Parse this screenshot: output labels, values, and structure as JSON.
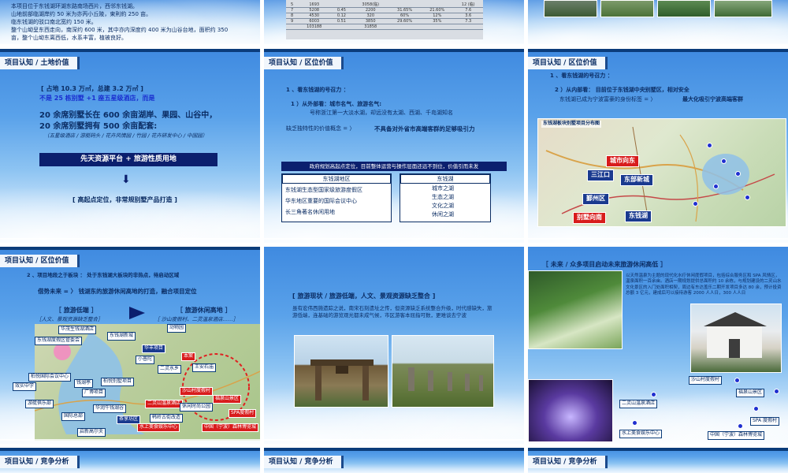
{
  "colors": {
    "slide_top": "#3f8ae0",
    "navy": "#0b2d64",
    "banner": "#0b1f6e",
    "red": "#d81c1c",
    "pin": "#1f2fd0"
  },
  "s1": {
    "lines": [
      "本项目位于东钱湖环湖东路南场西片，西邻东钱湖。",
      "山地前部临湖岸约 50 米为亦丙小丘陵，東則約 250 亩。",
      "临东钱湖的驳口南北宽约 150 米。",
      "整个山坳呈东西走向，南深约 600 米，其中亦内深度约 400 米为山谷台地，面积约 350",
      "亩，整个山坳东离西低，水系丰富，植被良好。"
    ]
  },
  "s2": {
    "rows": [
      [
        "5",
        "1693",
        "",
        "3058(临)",
        "",
        "",
        "12 (临)"
      ],
      [
        "7",
        "5208",
        "0.45",
        "2200",
        "31.65%",
        "21.60%",
        "7.6"
      ],
      [
        "8",
        "4530",
        "0.12",
        "320",
        "60%",
        "12%",
        "3.6"
      ],
      [
        "9",
        "6003",
        "0.51",
        "3850",
        "29.60%",
        "35%",
        "7.3"
      ],
      [
        "",
        "103188",
        "",
        "31858",
        "",
        "",
        ""
      ]
    ]
  },
  "s4": {
    "tag": "项目认知 / 土地价值",
    "line1": "[ 占地 10.3 万㎡，总建 3.2 万㎡ ]",
    "line2": "不是 25 栋别墅 +1 座五星级酒店，而是",
    "head1": "20 余席别墅长在 600 余亩湖岸、果园、山谷中，",
    "head2": "20 余席别墅拥有 500 余亩配套:",
    "sub": "（五星级酒店 / 游艇码头 / 花卉风情园 / 竹园 / 花卉研发中心 / 中国园）",
    "banner": "先天资源平台 + 旅游性质用地",
    "arrow": "⬇",
    "conclusion": "[ 高起点定位，非常规别墅产品打造 ]"
  },
  "s5": {
    "tag": "项目认知 / 区位价值",
    "h1": "1 、看东钱湖的号召力 ：",
    "p1": "1 ）从外部看：城市名气、旅游名气:",
    "p1b": "号称浙江第一大淡水湖，却远没有太湖、西湖、千岛湖知名",
    "p2": "缺乏独特性的价值概念  = 〉",
    "p2b": "不具备对外省市高端客群的足够吸引力",
    "banner": "政府规划高起点定位，目前整体运营与操作层面还远不到位，价值引而未发",
    "col1_head": "东钱湖地区",
    "col1": [
      "东钱湖生态型国家级旅游度假区",
      "华东地区重要的国际会议中心",
      "长三角著名休闲用地"
    ],
    "col2_head": "东钱湖",
    "col2": [
      "城市之湖",
      "生态之湖",
      "文化之湖",
      "休闲之湖"
    ]
  },
  "s6": {
    "tag": "项目认知 / 区位价值",
    "h1": "1 、看东钱湖的号召力 ：",
    "p1": "2 ）从内部看： 目前位于东钱湖中央别墅区，相对安全",
    "p1b": "东钱湖已成为宁波富豪的身份标签  = 〉",
    "p1c": "最大化吸引宁波高端客群",
    "map_title": "东钱湖板块别墅项目分布图",
    "labels": [
      "城市向东",
      "三江口",
      "东部新城",
      "鄞州区",
      "东钱湖",
      "别墅向南"
    ]
  },
  "s7": {
    "tag": "项目认知 / 区位价值",
    "h2": "2 、项目地段之于板块 ： 处于东钱湖大板块的非热点，待启动区域",
    "p": "借势未来 = 〉 钱湖东的旅游休闲高地的打造，融合项目定位",
    "left_head": "［ 旅游低端 ］",
    "left_sub": "［人文、景观资源缺乏整合］",
    "right_head": "［ 旅游休闲高地 ］",
    "right_sub": "［ 沙山度假村、二灵温泉酒店……］",
    "pins": [
      "华茂生钱湖酒店",
      "东钱湖度假区管委会",
      "东钱湖新城",
      "动物园",
      "华丰项目",
      "小普陀",
      "二灵水乡",
      "王安石庙",
      "本案",
      "柏悦国际会议中心",
      "柏悦别墅项目",
      "效实中学",
      "钱湖亭",
      "广博项目",
      "沙山村度假村",
      "游艇俱乐部",
      "华润牛钱湖谷",
      "二灵山温泉酒店",
      "国际总部",
      "韩岭古街改造",
      "茶享坊区",
      "福泉山景区",
      "SPA度假村",
      "启新高尔夫",
      "水上美食娱乐中心",
      "中国（宁波）森林博览城",
      "休闲时尚公园"
    ]
  },
  "s8": {
    "title": "[ 旅游现状 / 旅游低端，人文、景观资源缺乏整合 ]",
    "p": "虽有宏伟西施遗踪之说，南宋石刻遗址之传，但资源缺乏系统整合升级，时代感缺失，旅游低端，连基础的游览观光都未成气候，市区游客本屈指可数，更难谈去宁波"
  },
  "s9": {
    "title": "［ 未来 / 众多项目启动未来旅游休闲高低 ］",
    "p": "以天然温泉为主题的现代化水疗休闲度假项目，包括综合服务区和 SPA 风情区，温泉面积一百余亩。酒店一期规划提供总面积约 10 余栋，与规划建设的二灵山水文化景区的入门处面积相契，周边有东达盖乐二期开发项目多达 80 余，预计投资总额 3 亿元，建成后可以接待游客 2000 人人日，300 人人日",
    "pins": [
      "沙山村度假村",
      "福泉山景区",
      "二灵山温泉酒店",
      "SPA 度假村",
      "水上美食娱乐中心",
      "中国（宁波）森林博览城"
    ]
  },
  "s10": {
    "tag": "项目认知 / 竞争分析"
  },
  "s11": {
    "tag": "项目认知 / 竞争分析"
  },
  "s12": {
    "tag": "项目认知 / 竞争分析"
  }
}
